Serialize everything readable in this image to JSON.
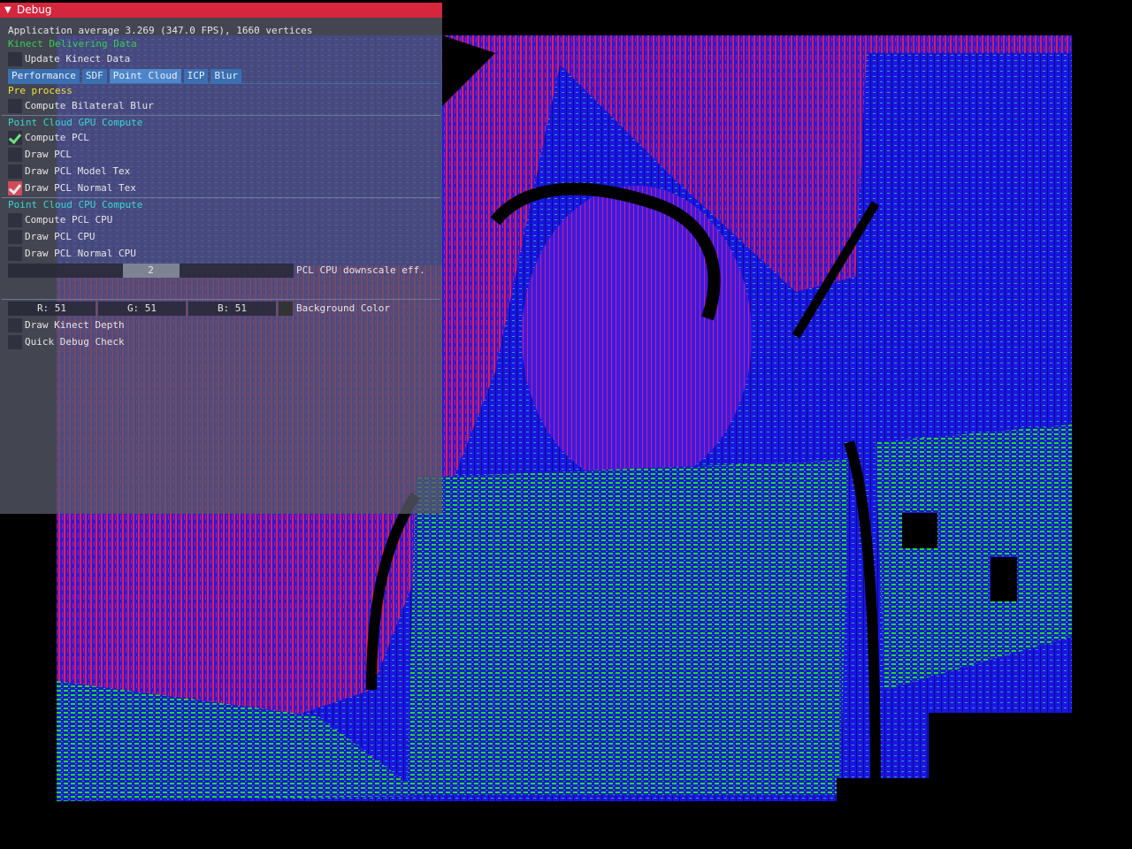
{
  "window": {
    "title": "Debug",
    "fps_line": "Application average 3.269 (347.0 FPS), 1660 vertices",
    "kinect_status": "Kinect Delivering Data",
    "update_kinect_label": "Update Kinect Data",
    "tabs": [
      {
        "label": "Performance"
      },
      {
        "label": "SDF"
      },
      {
        "label": "Point Cloud"
      },
      {
        "label": "ICP"
      },
      {
        "label": "Blur"
      }
    ],
    "preprocess": {
      "header": "Pre process",
      "compute_bilateral_blur": {
        "label": "Compute Bilateral Blur",
        "checked": false
      }
    },
    "gpu": {
      "header": "Point Cloud GPU Compute",
      "compute_pcl": {
        "label": "Compute PCL",
        "checked": true
      },
      "draw_pcl": {
        "label": "Draw PCL",
        "checked": false
      },
      "draw_pcl_model_tex": {
        "label": "Draw PCL Model Tex",
        "checked": false
      },
      "draw_pcl_normal_tex": {
        "label": "Draw PCL Normal Tex",
        "checked": true
      }
    },
    "cpu": {
      "header": "Point Cloud CPU Compute",
      "compute_pcl_cpu": {
        "label": "Compute PCL CPU",
        "checked": false
      },
      "draw_pcl_cpu": {
        "label": "Draw PCL CPU",
        "checked": false
      },
      "draw_pcl_normal_cpu": {
        "label": "Draw PCL Normal CPU",
        "checked": false
      },
      "downscale": {
        "value": "2",
        "label": "PCL CPU downscale eff."
      }
    },
    "background": {
      "r": "R: 51",
      "g": "G: 51",
      "b": "B: 51",
      "label": "Background Color",
      "swatch_color": "#333333"
    },
    "draw_kinect_depth": {
      "label": "Draw Kinect Depth",
      "checked": false
    },
    "quick_debug_check": {
      "label": "Quick Debug Check",
      "checked": false
    }
  },
  "colors": {
    "title_bar": "#d5263e",
    "accent_green": "#2fd44a",
    "accent_yellow": "#f2e33a",
    "accent_cyan": "#35d9d0",
    "tab_blue": "#3a6fb0"
  }
}
